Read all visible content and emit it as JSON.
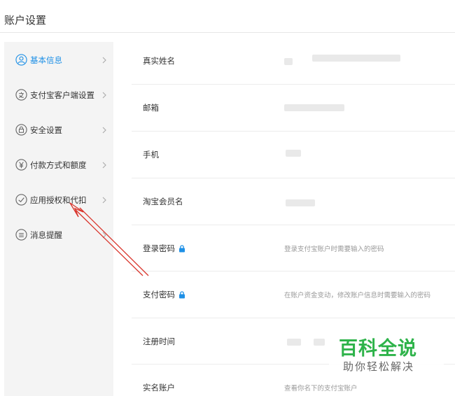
{
  "page": {
    "title": "账户设置"
  },
  "sidebar": {
    "items": [
      {
        "label": "基本信息",
        "icon": "user-circle-icon",
        "active": true
      },
      {
        "label": "支付宝客户端设置",
        "icon": "client-icon",
        "active": false
      },
      {
        "label": "安全设置",
        "icon": "lock-circle-icon",
        "active": false
      },
      {
        "label": "付款方式和额度",
        "icon": "yuan-circle-icon",
        "active": false
      },
      {
        "label": "应用授权和代扣",
        "icon": "check-circle-icon",
        "active": false
      },
      {
        "label": "消息提醒",
        "icon": "message-circle-icon",
        "active": false
      }
    ]
  },
  "rows": [
    {
      "label": "真实姓名",
      "value": ""
    },
    {
      "label": "邮箱",
      "value": ""
    },
    {
      "label": "手机",
      "value": ""
    },
    {
      "label": "淘宝会员名",
      "value": ""
    },
    {
      "label": "登录密码",
      "value": "登录支付宝账户时需要输入的密码",
      "lock": true
    },
    {
      "label": "支付密码",
      "value": "在账户资金变动，修改账户信息时需要输入的密码",
      "lock": true
    },
    {
      "label": "注册时间",
      "value": ""
    },
    {
      "label": "实名账户",
      "value": "查看你名下的支付宝账户"
    }
  ],
  "watermark": {
    "main": "百科全说",
    "sub": "助你轻松解决"
  },
  "colors": {
    "accent": "#1e90e6",
    "watermark_green": "#2eb34a",
    "annotation_red": "#d9342b"
  }
}
